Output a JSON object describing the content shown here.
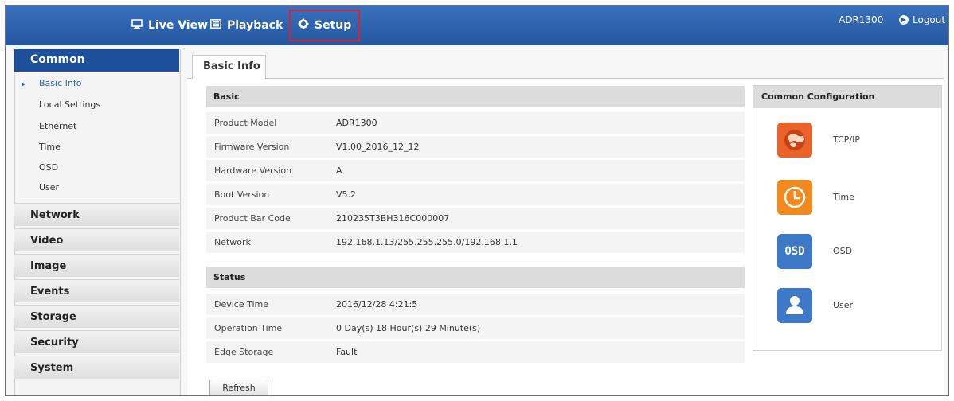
{
  "topbar": {
    "nav": [
      {
        "label": "Live View",
        "icon": "monitor-icon"
      },
      {
        "label": "Playback",
        "icon": "film-icon"
      },
      {
        "label": "Setup",
        "icon": "gear-icon"
      }
    ],
    "device_name": "ADR1300",
    "logout_label": "Logout"
  },
  "sidebar": {
    "active_section": "Common",
    "sub_items": [
      "Basic Info",
      "Local Settings",
      "Ethernet",
      "Time",
      "OSD",
      "User"
    ],
    "categories": [
      "Network",
      "Video",
      "Image",
      "Events",
      "Storage",
      "Security",
      "System"
    ]
  },
  "tab": {
    "label": "Basic Info"
  },
  "basic": {
    "title": "Basic",
    "rows": [
      {
        "label": "Product Model",
        "value": "ADR1300"
      },
      {
        "label": "Firmware Version",
        "value": "V1.00_2016_12_12"
      },
      {
        "label": "Hardware Version",
        "value": "A"
      },
      {
        "label": "Boot Version",
        "value": "V5.2"
      },
      {
        "label": "Product Bar Code",
        "value": "210235T3BH316C000007"
      },
      {
        "label": "Network",
        "value": "192.168.1.13/255.255.255.0/192.168.1.1"
      }
    ]
  },
  "status": {
    "title": "Status",
    "rows": [
      {
        "label": "Device Time",
        "value": "2016/12/28 4:21:5"
      },
      {
        "label": "Operation Time",
        "value": "0 Day(s) 18 Hour(s) 29 Minute(s)"
      },
      {
        "label": "Edge Storage",
        "value": "Fault"
      }
    ]
  },
  "refresh_label": "Refresh",
  "common_config": {
    "title": "Common Configuration",
    "items": [
      {
        "label": "TCP/IP",
        "icon": "network-icon",
        "color": "#e8622a"
      },
      {
        "label": "Time",
        "icon": "clock-icon",
        "color": "#f08a1f"
      },
      {
        "label": "OSD",
        "icon": "osd-icon",
        "icon_text": "OSD",
        "color": "#3d79c6"
      },
      {
        "label": "User",
        "icon": "user-icon",
        "color": "#3d79c6"
      }
    ]
  },
  "colors": {
    "topbar": "#2d5fa8",
    "sidebar_active": "#1d4f9b",
    "highlight_border": "#d9232d"
  }
}
